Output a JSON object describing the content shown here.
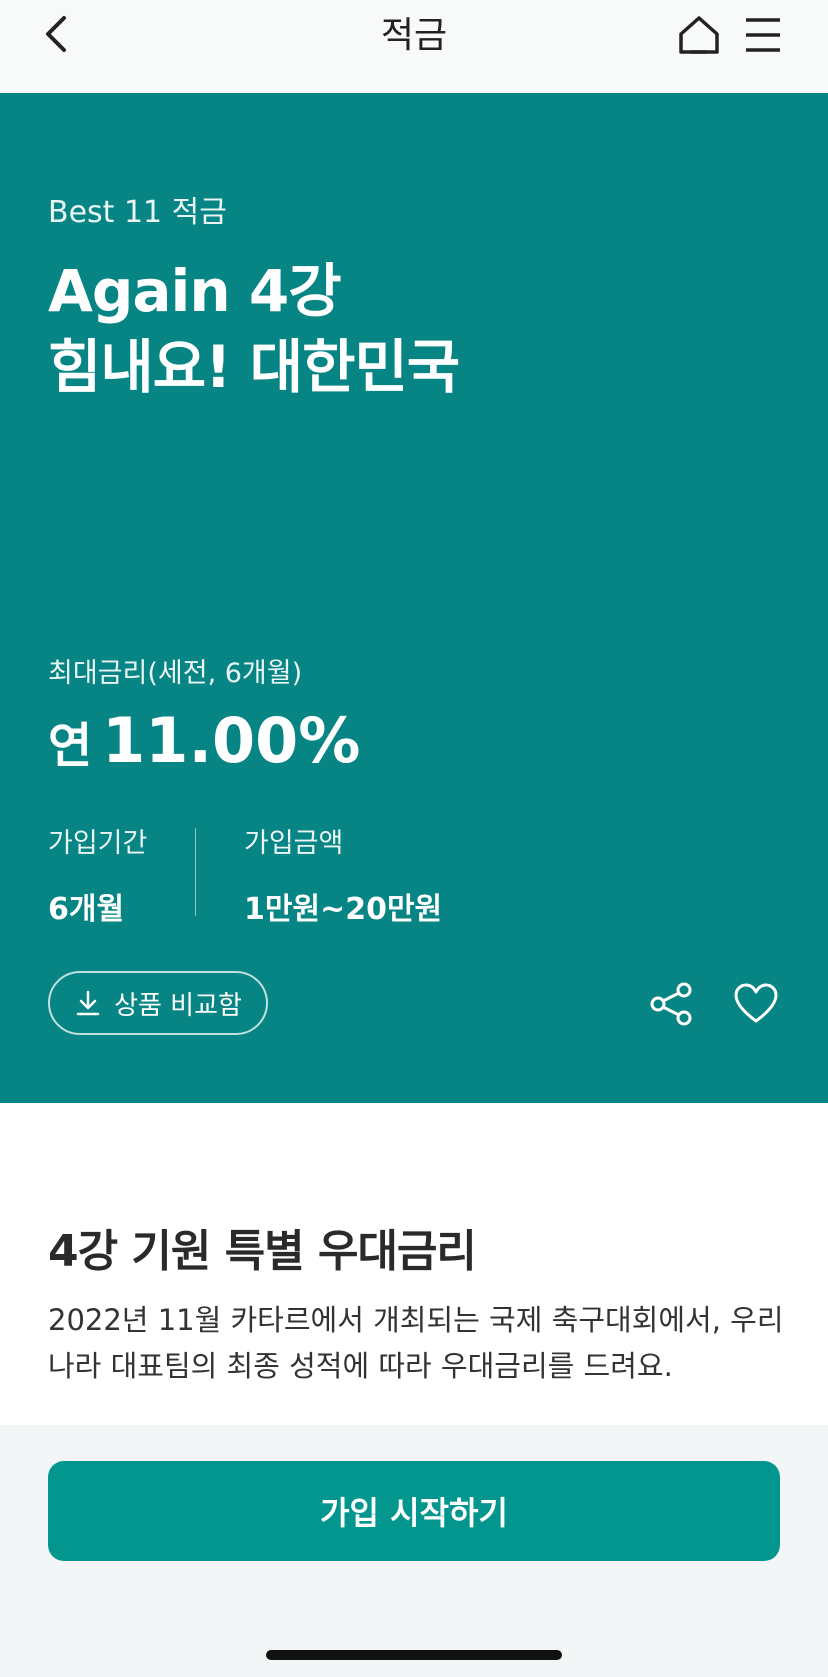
{
  "header": {
    "title": "적금",
    "back_icon": "chevron-left-icon",
    "home_icon": "home-icon",
    "menu_icon": "hamburger-menu-icon"
  },
  "hero": {
    "background": "#078584",
    "subtitle": "Best 11 적금",
    "headline_line1": "Again 4강",
    "headline_line2": "힘내요! 대한민국",
    "rate_label": "최대금리(세전, 6개월)",
    "rate_prefix": "연",
    "rate_value": "11.00%",
    "period_label": "가입기간",
    "period_value": "6개월",
    "amount_label": "가입금액",
    "amount_value": "1만원~20만원",
    "compare_button": "상품 비교함",
    "share_icon": "share-icon",
    "like_icon": "heart-icon"
  },
  "content": {
    "heading": "4강 기원 특별 우대금리",
    "description": "2022년 11월 카타르에서 개최되는 국제 축구대회에서, 우리나라 대표팀의 최종 성적에 따라 우대금리를 드려요."
  },
  "cta": {
    "label": "가입 시작하기",
    "color": "#03968e"
  }
}
